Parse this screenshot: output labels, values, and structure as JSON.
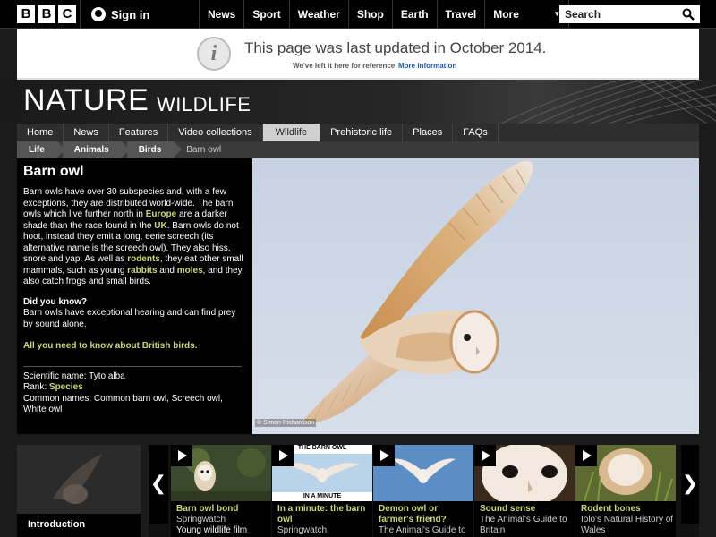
{
  "topbar": {
    "signin": "Sign in",
    "nav": [
      "News",
      "Sport",
      "Weather",
      "Shop",
      "Earth",
      "Travel"
    ],
    "more": "More",
    "search_placeholder": "Search",
    "logo_letters": [
      "B",
      "B",
      "C"
    ]
  },
  "notice": {
    "title": "This page was last updated in October 2014.",
    "sub": "We've left it here for reference",
    "link": "More information",
    "icon": "i"
  },
  "header": {
    "title": "NATURE",
    "subtitle": "WILDLIFE"
  },
  "section_nav": {
    "items": [
      "Home",
      "News",
      "Features",
      "Video collections",
      "Wildlife",
      "Prehistoric life",
      "Places",
      "FAQs"
    ],
    "active": "Wildlife"
  },
  "breadcrumb": [
    "Life",
    "Animals",
    "Birds",
    "Barn owl"
  ],
  "article": {
    "title": "Barn owl",
    "intro_parts": {
      "p1": "Barn owls have over 30 subspecies and, with a few exceptions, they are distributed world-wide. The barn owls which live further north in ",
      "europe": "Europe",
      "p2": " are a darker shade than the race found in the ",
      "uk": "UK",
      "p3": ". Barn owls do not hoot, instead they emit a long, eerie screech (its alternative name is the screech owl). They also hiss, snore and yap. As well as ",
      "rodents": "rodents",
      "p4": ", they eat other small mammals, such as young ",
      "rabbits": "rabbits",
      "p5": " and ",
      "moles": "moles",
      "p6": ", and they also catch frogs and small birds."
    },
    "dyk_heading": "Did you know?",
    "dyk_text": "Barn owls have exceptional hearing and can find prey by sound alone.",
    "british_link": "All you need to know about British birds.",
    "scientific": "Scientific name: Tyto alba",
    "rank_label": "Rank: ",
    "rank_value": "Species",
    "common_names": "Common names: Common barn owl, Screech owl, White owl"
  },
  "hero": {
    "credit": "© Simon Richardson"
  },
  "carousel": {
    "intro": "Introduction",
    "prev": "❮",
    "next": "❯",
    "cards": [
      {
        "title": "Barn owl bond",
        "sub": "Springwatch",
        "extra": "Young wildlife film"
      },
      {
        "title": "In a minute: the barn owl",
        "sub": "Springwatch",
        "thumb_title": "THE BARN OWL",
        "thumb_caption": "IN A MINUTE"
      },
      {
        "title": "Demon owl or farmer's friend?",
        "sub": "The Animal's Guide to"
      },
      {
        "title": "Sound sense",
        "sub": "The Animal's Guide to Britain"
      },
      {
        "title": "Rodent bones",
        "sub": "Iolo's Natural History of Wales"
      }
    ]
  },
  "colors": {
    "accent": "#c8d96f",
    "link_blue": "#1a55a8",
    "sky": "#cfd9e7"
  }
}
